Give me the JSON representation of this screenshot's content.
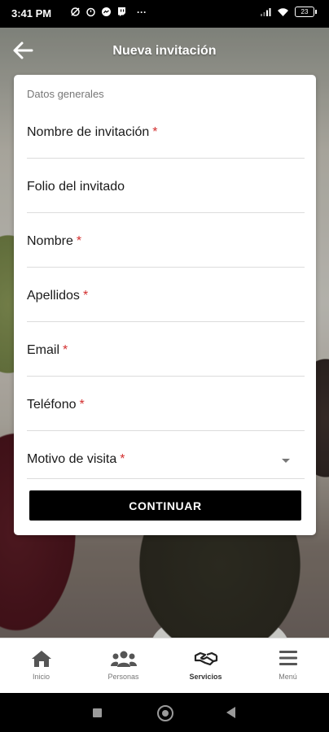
{
  "status_bar": {
    "time": "3:41 PM",
    "left_icons": [
      "sync-icon",
      "alarm-icon",
      "messenger-icon",
      "twitch-icon",
      "more-dots-icon"
    ],
    "more": "···",
    "battery": "23"
  },
  "header": {
    "title": "Nueva invitación",
    "back_icon": "arrow-left-icon"
  },
  "form": {
    "section_label": "Datos generales",
    "fields": [
      {
        "label": "Nombre de invitación",
        "required": true
      },
      {
        "label": "Folio del invitado",
        "required": false
      },
      {
        "label": "Nombre",
        "required": true
      },
      {
        "label": "Apellidos",
        "required": true
      },
      {
        "label": "Email",
        "required": true
      },
      {
        "label": "Teléfono",
        "required": true
      },
      {
        "label": "Motivo de visita",
        "required": true,
        "type": "select"
      }
    ],
    "required_mark": "*",
    "continue_label": "CONTINUAR"
  },
  "bottom_nav": {
    "items": [
      {
        "label": "Inicio",
        "icon": "home-icon",
        "active": false
      },
      {
        "label": "Personas",
        "icon": "people-icon",
        "active": false
      },
      {
        "label": "Servicios",
        "icon": "handshake-icon",
        "active": true
      },
      {
        "label": "Menú",
        "icon": "menu-icon",
        "active": false
      }
    ]
  },
  "colors": {
    "accent": "#000000",
    "required": "#d32f2f"
  }
}
